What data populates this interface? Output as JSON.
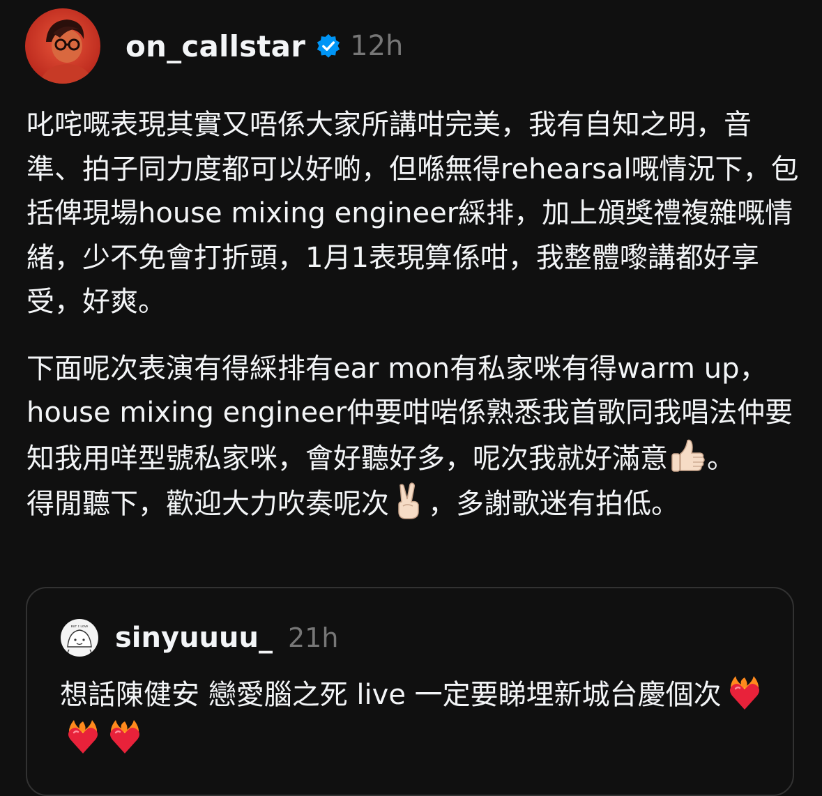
{
  "post": {
    "username": "on_callstar",
    "time": "12h",
    "verified": true,
    "paragraphs": [
      "叱咤嘅表現其實又唔係大家所講咁完美，我有自知之明，音準、拍子同力度都可以好啲，但喺無得rehearsal嘅情況下，包括俾現場house mixing engineer綵排，加上頒獎禮複雜嘅情緒，少不免會打折頭，1月1表現算係咁，我整體嚟講都好享受，好爽。",
      "下面呢次表演有得綵排有ear mon有私家咪有得warm up，house mixing engineer仲要咁啱係熟悉我首歌同我唱法仲要知我用咩型號私家咪，會好聽好多，呢次我就好滿意",
      "。",
      "得閒聽下，歡迎大力吹奏呢次",
      "，多謝歌迷有拍低。"
    ],
    "emoji_thumbs": "thumbs-up-emoji",
    "emoji_victory": "victory-hand-emoji"
  },
  "quote": {
    "username": "sinyuuuu_",
    "time": "21h",
    "text": "想話陳健安 戀愛腦之死 live 一定要睇埋新城台慶個次",
    "emoji": "heart-on-fire-emoji",
    "emoji_count": 3
  },
  "colors": {
    "background": "#101010",
    "text": "#f3f5f7",
    "muted": "#777777",
    "verified": "#0095f6",
    "border": "#323232"
  }
}
